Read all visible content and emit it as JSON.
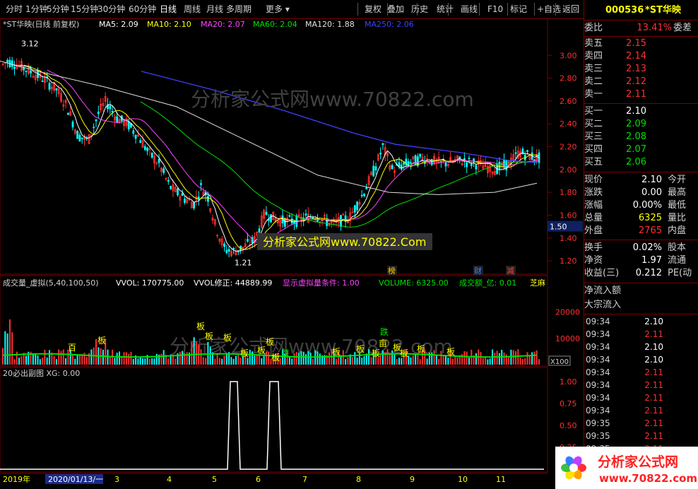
{
  "toolbar": {
    "period_tabs": [
      "分时",
      "1分钟",
      "5分钟",
      "15分钟",
      "30分钟",
      "60分钟",
      "日线",
      "周线",
      "月线",
      "多周期",
      "更多"
    ],
    "active_tab": "日线",
    "tools": [
      "复权",
      "叠加",
      "历史",
      "统计",
      "画线",
      "F10",
      "标记",
      "+自选",
      "返回"
    ]
  },
  "chart": {
    "title": "*ST华映(日线 前复权)",
    "ma_labels": [
      {
        "text": "MA5: 2.09",
        "color": "#ffffff"
      },
      {
        "text": "MA10: 2.10",
        "color": "#ffff00"
      },
      {
        "text": "MA20: 2.07",
        "color": "#ff44ff"
      },
      {
        "text": "MA60: 2.04",
        "color": "#00e000"
      },
      {
        "text": "MA120: 1.88",
        "color": "#e0e0e0"
      },
      {
        "text": "MA250: 2.06",
        "color": "#4040ff"
      }
    ],
    "price_ticks": [
      "3.00",
      "2.80",
      "2.60",
      "2.40",
      "2.20",
      "2.00",
      "1.80",
      "1.60",
      "1.40",
      "1.20"
    ],
    "price_min": 1.12,
    "price_max": 3.2,
    "current_price_tag": "1.50",
    "high_label": "3.12",
    "low_label": "1.21",
    "watermark_main": "分析家公式网www.70822.com",
    "banner": "分析家公式网www.70822.Com",
    "event_marks": [
      "榜",
      "财",
      "减"
    ],
    "volume_title": "成交量_虚拟(5,40,100,50)",
    "volume_labels": [
      {
        "text": "VVOL: 170775.00",
        "color": "#ffffff"
      },
      {
        "text": "VVOL修正: 44889.99",
        "color": "#ffffff"
      },
      {
        "text": "显示虚拟量条件: 1.00",
        "color": "#ff44ff"
      },
      {
        "text": "VOLUME: 6325.00",
        "color": "#00e000"
      },
      {
        "text": "成交额_亿: 0.01",
        "color": "#00e000"
      },
      {
        "text": "芝麻",
        "color": "#ffff00"
      }
    ],
    "volume_ticks": [
      "20000",
      "10000"
    ],
    "volume_unit": "X100",
    "volume_watermark": "分析家公式网www.70822.com",
    "volume_tags": [
      "百",
      "板",
      "板",
      "板",
      "板",
      "板",
      "板",
      "板",
      "跌",
      "板",
      "板",
      "板",
      "跌",
      "亩",
      "板",
      "板",
      "板",
      "板",
      "板"
    ],
    "indicator_title": "20必出副图 XG: 0.00",
    "indicator_ticks": [
      "1.00",
      "0.75",
      "0.50",
      "0.25"
    ],
    "date_labels": [
      "2019年",
      "2020/01/13/一",
      "3",
      "4",
      "5",
      "6",
      "7",
      "8",
      "9",
      "10",
      "11"
    ]
  },
  "quote": {
    "code": "000536",
    "name": "*ST华映",
    "weibi_label": "委比",
    "weibi_value": "13.41%",
    "weicha_label": "委差",
    "asks": [
      {
        "label": "卖五",
        "price": "2.15"
      },
      {
        "label": "卖四",
        "price": "2.14"
      },
      {
        "label": "卖三",
        "price": "2.13"
      },
      {
        "label": "卖二",
        "price": "2.12"
      },
      {
        "label": "卖一",
        "price": "2.11"
      }
    ],
    "bids": [
      {
        "label": "买一",
        "price": "2.10",
        "color": "#ffffff"
      },
      {
        "label": "买二",
        "price": "2.09",
        "color": "#00e000"
      },
      {
        "label": "买三",
        "price": "2.08",
        "color": "#00e000"
      },
      {
        "label": "买四",
        "price": "2.07",
        "color": "#00e000"
      },
      {
        "label": "买五",
        "price": "2.06",
        "color": "#00e000"
      }
    ],
    "stats": [
      {
        "label": "现价",
        "value": "2.10",
        "color": "#ffffff",
        "label2": "今开"
      },
      {
        "label": "涨跌",
        "value": "0.00",
        "color": "#ffffff",
        "label2": "最高"
      },
      {
        "label": "涨幅",
        "value": "0.00%",
        "color": "#ffffff",
        "label2": "最低"
      },
      {
        "label": "总量",
        "value": "6325",
        "color": "#ffff00",
        "label2": "量比"
      },
      {
        "label": "外盘",
        "value": "2765",
        "color": "#ff3030",
        "label2": "内盘"
      }
    ],
    "stats2": [
      {
        "label": "换手",
        "value": "0.02%",
        "color": "#ffffff",
        "label2": "股本"
      },
      {
        "label": "净资",
        "value": "1.97",
        "color": "#ffffff",
        "label2": "流通"
      },
      {
        "label": "收益(三)",
        "value": "0.212",
        "color": "#ffffff",
        "label2": "PE(动"
      }
    ],
    "flow": [
      "净流入额",
      "大宗流入"
    ],
    "ticks": [
      {
        "time": "09:34",
        "price": "2.10",
        "color": "#ffffff"
      },
      {
        "time": "09:34",
        "price": "2.11",
        "color": "#ff3030"
      },
      {
        "time": "09:34",
        "price": "2.10",
        "color": "#ffffff"
      },
      {
        "time": "09:34",
        "price": "2.10",
        "color": "#ffffff"
      },
      {
        "time": "09:34",
        "price": "2.11",
        "color": "#ff3030"
      },
      {
        "time": "09:34",
        "price": "2.11",
        "color": "#ff3030"
      },
      {
        "time": "09:34",
        "price": "2.11",
        "color": "#ff3030"
      },
      {
        "time": "09:34",
        "price": "2.11",
        "color": "#ff3030"
      },
      {
        "time": "09:35",
        "price": "2.11",
        "color": "#ff3030"
      },
      {
        "time": "09:35",
        "price": "2.11",
        "color": "#ff3030"
      },
      {
        "time": "09:35",
        "price": "2.11",
        "color": "#ff3030"
      }
    ]
  },
  "logo": {
    "line1": "分析家公式网",
    "line2": "www.70822.com"
  },
  "colors": {
    "up": "#ff3030",
    "down": "#00ffff",
    "grid": "#7a0000",
    "ma5": "#ffffff",
    "ma10": "#ffff00",
    "ma20": "#ff44ff",
    "ma60": "#00e000",
    "ma120": "#e0e0e0",
    "ma250": "#4040ff"
  }
}
